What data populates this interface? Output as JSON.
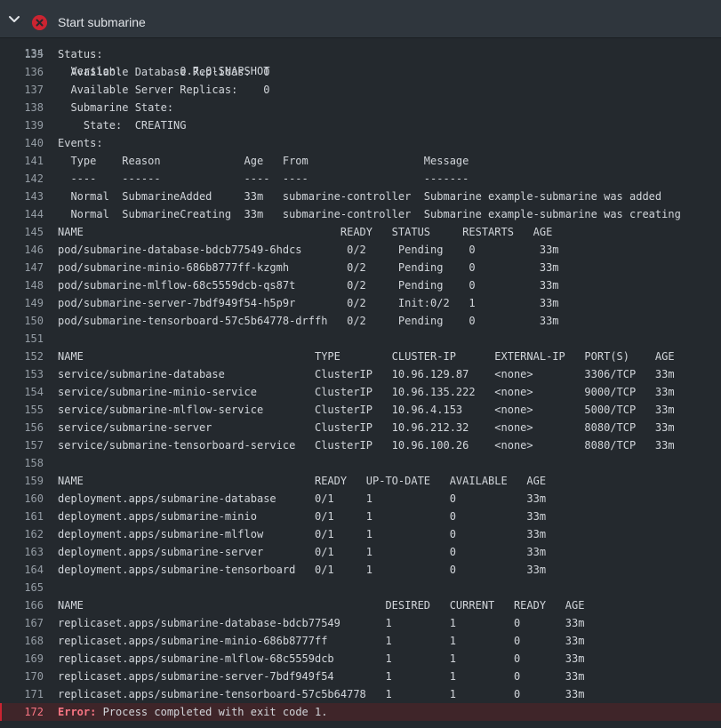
{
  "header": {
    "title": "Start submarine",
    "error_color": "#cb2431",
    "icons": [
      "chevron-down-icon",
      "x-circle-icon"
    ]
  },
  "partial_line": {
    "number": "134",
    "text": "  Version:         0.7.0-SNAPSHOT"
  },
  "lines": [
    {
      "number": "135",
      "text": "Status:"
    },
    {
      "number": "136",
      "text": "  Available Database Replicas:  0"
    },
    {
      "number": "137",
      "text": "  Available Server Replicas:    0"
    },
    {
      "number": "138",
      "text": "  Submarine State:"
    },
    {
      "number": "139",
      "text": "    State:  CREATING"
    },
    {
      "number": "140",
      "text": "Events:"
    },
    {
      "number": "141",
      "text": "  Type    Reason             Age   From                  Message"
    },
    {
      "number": "142",
      "text": "  ----    ------             ----  ----                  -------"
    },
    {
      "number": "143",
      "text": "  Normal  SubmarineAdded     33m   submarine-controller  Submarine example-submarine was added"
    },
    {
      "number": "144",
      "text": "  Normal  SubmarineCreating  33m   submarine-controller  Submarine example-submarine was creating"
    },
    {
      "number": "145",
      "text": "NAME                                        READY   STATUS     RESTARTS   AGE"
    },
    {
      "number": "146",
      "text": "pod/submarine-database-bdcb77549-6hdcs       0/2     Pending    0          33m"
    },
    {
      "number": "147",
      "text": "pod/submarine-minio-686b8777ff-kzgmh         0/2     Pending    0          33m"
    },
    {
      "number": "148",
      "text": "pod/submarine-mlflow-68c5559dcb-qs87t        0/2     Pending    0          33m"
    },
    {
      "number": "149",
      "text": "pod/submarine-server-7bdf949f54-h5p9r        0/2     Init:0/2   1          33m"
    },
    {
      "number": "150",
      "text": "pod/submarine-tensorboard-57c5b64778-drffh   0/2     Pending    0          33m"
    },
    {
      "number": "151",
      "text": ""
    },
    {
      "number": "152",
      "text": "NAME                                    TYPE        CLUSTER-IP      EXTERNAL-IP   PORT(S)    AGE"
    },
    {
      "number": "153",
      "text": "service/submarine-database              ClusterIP   10.96.129.87    <none>        3306/TCP   33m"
    },
    {
      "number": "154",
      "text": "service/submarine-minio-service         ClusterIP   10.96.135.222   <none>        9000/TCP   33m"
    },
    {
      "number": "155",
      "text": "service/submarine-mlflow-service        ClusterIP   10.96.4.153     <none>        5000/TCP   33m"
    },
    {
      "number": "156",
      "text": "service/submarine-server                ClusterIP   10.96.212.32    <none>        8080/TCP   33m"
    },
    {
      "number": "157",
      "text": "service/submarine-tensorboard-service   ClusterIP   10.96.100.26    <none>        8080/TCP   33m"
    },
    {
      "number": "158",
      "text": ""
    },
    {
      "number": "159",
      "text": "NAME                                    READY   UP-TO-DATE   AVAILABLE   AGE"
    },
    {
      "number": "160",
      "text": "deployment.apps/submarine-database      0/1     1            0           33m"
    },
    {
      "number": "161",
      "text": "deployment.apps/submarine-minio         0/1     1            0           33m"
    },
    {
      "number": "162",
      "text": "deployment.apps/submarine-mlflow        0/1     1            0           33m"
    },
    {
      "number": "163",
      "text": "deployment.apps/submarine-server        0/1     1            0           33m"
    },
    {
      "number": "164",
      "text": "deployment.apps/submarine-tensorboard   0/1     1            0           33m"
    },
    {
      "number": "165",
      "text": ""
    },
    {
      "number": "166",
      "text": "NAME                                               DESIRED   CURRENT   READY   AGE"
    },
    {
      "number": "167",
      "text": "replicaset.apps/submarine-database-bdcb77549       1         1         0       33m"
    },
    {
      "number": "168",
      "text": "replicaset.apps/submarine-minio-686b8777ff         1         1         0       33m"
    },
    {
      "number": "169",
      "text": "replicaset.apps/submarine-mlflow-68c5559dcb        1         1         0       33m"
    },
    {
      "number": "170",
      "text": "replicaset.apps/submarine-server-7bdf949f54        1         1         0       33m"
    },
    {
      "number": "171",
      "text": "replicaset.apps/submarine-tensorboard-57c5b64778   1         1         0       33m"
    }
  ],
  "error_line": {
    "number": "172",
    "label": "Error:",
    "message": " Process completed with exit code 1."
  }
}
